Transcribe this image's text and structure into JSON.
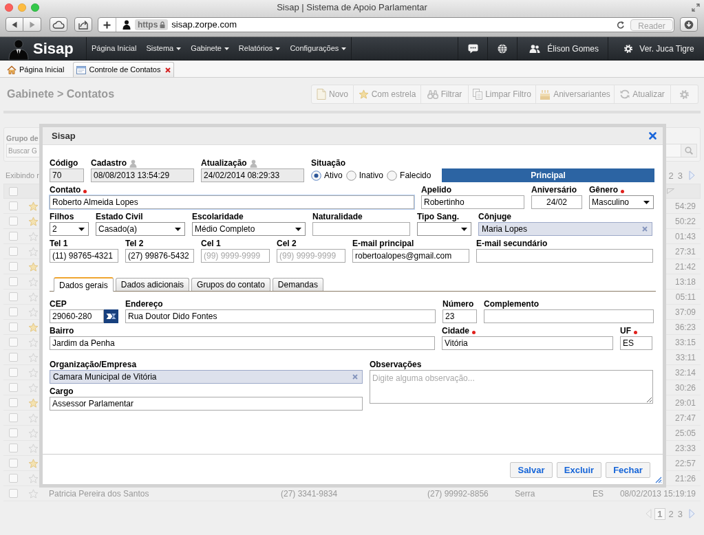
{
  "browser": {
    "title": "Sisap | Sistema de Apoio Parlamentar",
    "scheme": "https",
    "url": "sisap.zorpe.com",
    "reader": {
      "label": "Reader",
      "disabled": true
    }
  },
  "navbar": {
    "logo": "Sisap",
    "menu": [
      {
        "label": "Página Inicial",
        "dropdown": false
      },
      {
        "label": "Sistema",
        "dropdown": true
      },
      {
        "label": "Gabinete",
        "dropdown": true
      },
      {
        "label": "Relatórios",
        "dropdown": true
      },
      {
        "label": "Configurações",
        "dropdown": true
      }
    ],
    "user": "Élison Gomes",
    "profile": "Ver. Juca Tigre"
  },
  "tabs": [
    {
      "label": "Página Inicial",
      "kind": "home",
      "selected": false,
      "closable": false
    },
    {
      "label": "Controle de Contatos",
      "kind": "window",
      "selected": true,
      "closable": true
    }
  ],
  "page": {
    "breadcrumb": "Gabinete > Contatos",
    "toolbar": [
      {
        "label": "Novo"
      },
      {
        "label": "Com estrela"
      },
      {
        "label": "Filtrar"
      },
      {
        "label": "Limpar Filtro"
      },
      {
        "label": "Aniversariantes"
      },
      {
        "label": "Atualizar"
      }
    ],
    "filter_label": "Grupo de",
    "search_placeholder": "Buscar G",
    "summary": "Exibindo r",
    "top_pager": [
      {
        "label": "2",
        "selected": false
      },
      {
        "label": "3",
        "selected": false
      }
    ],
    "select_all": {
      "checked": false
    },
    "rows": [
      {
        "checked": false,
        "starred": true,
        "column_8": "54:29"
      },
      {
        "checked": false,
        "starred": true,
        "column_8": "50:22"
      },
      {
        "checked": false,
        "starred": false,
        "column_8": "01:43"
      },
      {
        "checked": false,
        "starred": false,
        "column_8": "27:31"
      },
      {
        "checked": false,
        "starred": true,
        "column_8": "21:42"
      },
      {
        "checked": false,
        "starred": false,
        "column_8": "13:18"
      },
      {
        "checked": false,
        "starred": false,
        "column_8": "05:11"
      },
      {
        "checked": false,
        "starred": false,
        "column_8": "37:09"
      },
      {
        "checked": false,
        "starred": true,
        "column_8": "36:23"
      },
      {
        "checked": false,
        "starred": false,
        "column_8": "33:15"
      },
      {
        "checked": false,
        "starred": false,
        "column_8": "33:11"
      },
      {
        "checked": false,
        "starred": false,
        "column_8": "32:14"
      },
      {
        "checked": false,
        "starred": false,
        "column_8": "30:26"
      },
      {
        "checked": false,
        "starred": true,
        "column_8": "29:01"
      },
      {
        "checked": false,
        "starred": false,
        "column_8": "27:47"
      },
      {
        "checked": false,
        "starred": false,
        "column_8": "25:05"
      },
      {
        "checked": false,
        "starred": false,
        "column_8": "23:33"
      },
      {
        "checked": false,
        "starred": true,
        "column_8": "22:57"
      },
      {
        "checked": false,
        "starred": false,
        "column_8": "21:26"
      },
      {
        "checked": false,
        "starred": false,
        "column_3": "Patricia Pereira dos Santos",
        "column_4": "(27) 3341-9834",
        "column_5": "(27) 99992-8856",
        "column_6": "Serra",
        "column_7": "ES",
        "column_8": "08/02/2013 15:19:19"
      }
    ],
    "bottom_pager": [
      {
        "label": "1",
        "selected": true
      },
      {
        "label": "2",
        "selected": false
      },
      {
        "label": "3",
        "selected": false
      }
    ]
  },
  "dialog": {
    "title": "Sisap",
    "header_rows": [
      [
        {
          "kind": "readonly",
          "label": "Código",
          "value": "70"
        },
        {
          "kind": "stamp",
          "label": "Cadastro",
          "value": "08/08/2013 13:54:29"
        },
        {
          "kind": "stamp",
          "label": "Atualização",
          "value": "24/02/2014 08:29:33"
        },
        {
          "kind": "radio",
          "label": "Situação",
          "options": [
            {
              "label": "Ativo",
              "selected": true
            },
            {
              "label": "Inativo",
              "selected": false
            },
            {
              "label": "Falecido",
              "selected": false
            }
          ]
        },
        {
          "kind": "banner",
          "label": "Principal"
        }
      ],
      [
        {
          "kind": "text",
          "label": "Contato",
          "required": true,
          "focused": true,
          "value": "Roberto Almeida Lopes"
        },
        {
          "kind": "text",
          "label": "Apelido",
          "required": false,
          "focused": false,
          "value": "Robertinho"
        },
        {
          "kind": "date",
          "label": "Aniversário",
          "required": false,
          "focused": false,
          "value": "24/02"
        },
        {
          "kind": "select",
          "label": "Gênero",
          "required": true,
          "value": "Masculino"
        }
      ],
      [
        {
          "kind": "select",
          "label": "Filhos",
          "required": false,
          "value": "2"
        },
        {
          "kind": "select",
          "label": "Estado Civil",
          "required": false,
          "value": "Casado(a)"
        },
        {
          "kind": "select",
          "label": "Escolaridade",
          "required": false,
          "value": "Médio Completo"
        },
        {
          "kind": "text",
          "label": "Naturalidade",
          "required": false,
          "focused": false
        },
        {
          "kind": "select",
          "label": "Tipo Sang.",
          "required": false
        },
        {
          "kind": "tag",
          "label": "Cônjuge",
          "required": false,
          "value": "Maria Lopes"
        }
      ],
      [
        {
          "kind": "text",
          "label": "Tel 1",
          "required": false,
          "focused": false,
          "value": "(11) 98765-4321"
        },
        {
          "kind": "text",
          "label": "Tel 2",
          "required": false,
          "focused": false,
          "value": "(27) 99876-5432"
        },
        {
          "kind": "text",
          "label": "Cel 1",
          "required": false,
          "focused": false,
          "placeholder": "(99) 9999-9999"
        },
        {
          "kind": "text",
          "label": "Cel 2",
          "required": false,
          "focused": false,
          "placeholder": "(99) 9999-9999"
        },
        {
          "kind": "text",
          "label": "E-mail principal",
          "required": false,
          "focused": false,
          "value": "robertoalopes@gmail.com"
        },
        {
          "kind": "text",
          "label": "E-mail secundário",
          "required": false,
          "focused": false
        }
      ]
    ],
    "tabs": [
      {
        "label": "Dados gerais",
        "selected": true
      },
      {
        "label": "Dados adicionais",
        "selected": false
      },
      {
        "label": "Grupos do contato",
        "selected": false
      },
      {
        "label": "Demandas",
        "selected": false
      }
    ],
    "tab_rows": [
      [
        {
          "kind": "cep",
          "label": "CEP",
          "required": false,
          "value": "29060-280"
        },
        {
          "kind": "text",
          "label": "Endereço",
          "required": false,
          "focused": false,
          "value": "Rua Doutor Dido Fontes"
        },
        {
          "kind": "text",
          "label": "Número",
          "required": false,
          "focused": false,
          "value": "23"
        },
        {
          "kind": "text",
          "label": "Complemento",
          "required": false,
          "focused": false
        }
      ],
      [
        {
          "kind": "text",
          "label": "Bairro",
          "required": false,
          "focused": false,
          "value": "Jardim da Penha"
        },
        {
          "kind": "text",
          "label": "Cidade",
          "required": true,
          "focused": false,
          "value": "Vitória"
        },
        {
          "kind": "text",
          "label": "UF",
          "required": true,
          "focused": false,
          "value": "ES"
        }
      ]
    ],
    "company": [
      {
        "kind": "tag",
        "label": "Organização/Empresa",
        "required": false,
        "value": "Camara Municipal de Vitória"
      },
      {
        "kind": "text",
        "label": "Cargo",
        "required": false,
        "focused": false,
        "value": "Assessor Parlamentar"
      }
    ],
    "notes": {
      "label": "Observações",
      "placeholder": "Digite alguma observação..."
    },
    "buttons": [
      "Salvar",
      "Excluir",
      "Fechar"
    ]
  }
}
